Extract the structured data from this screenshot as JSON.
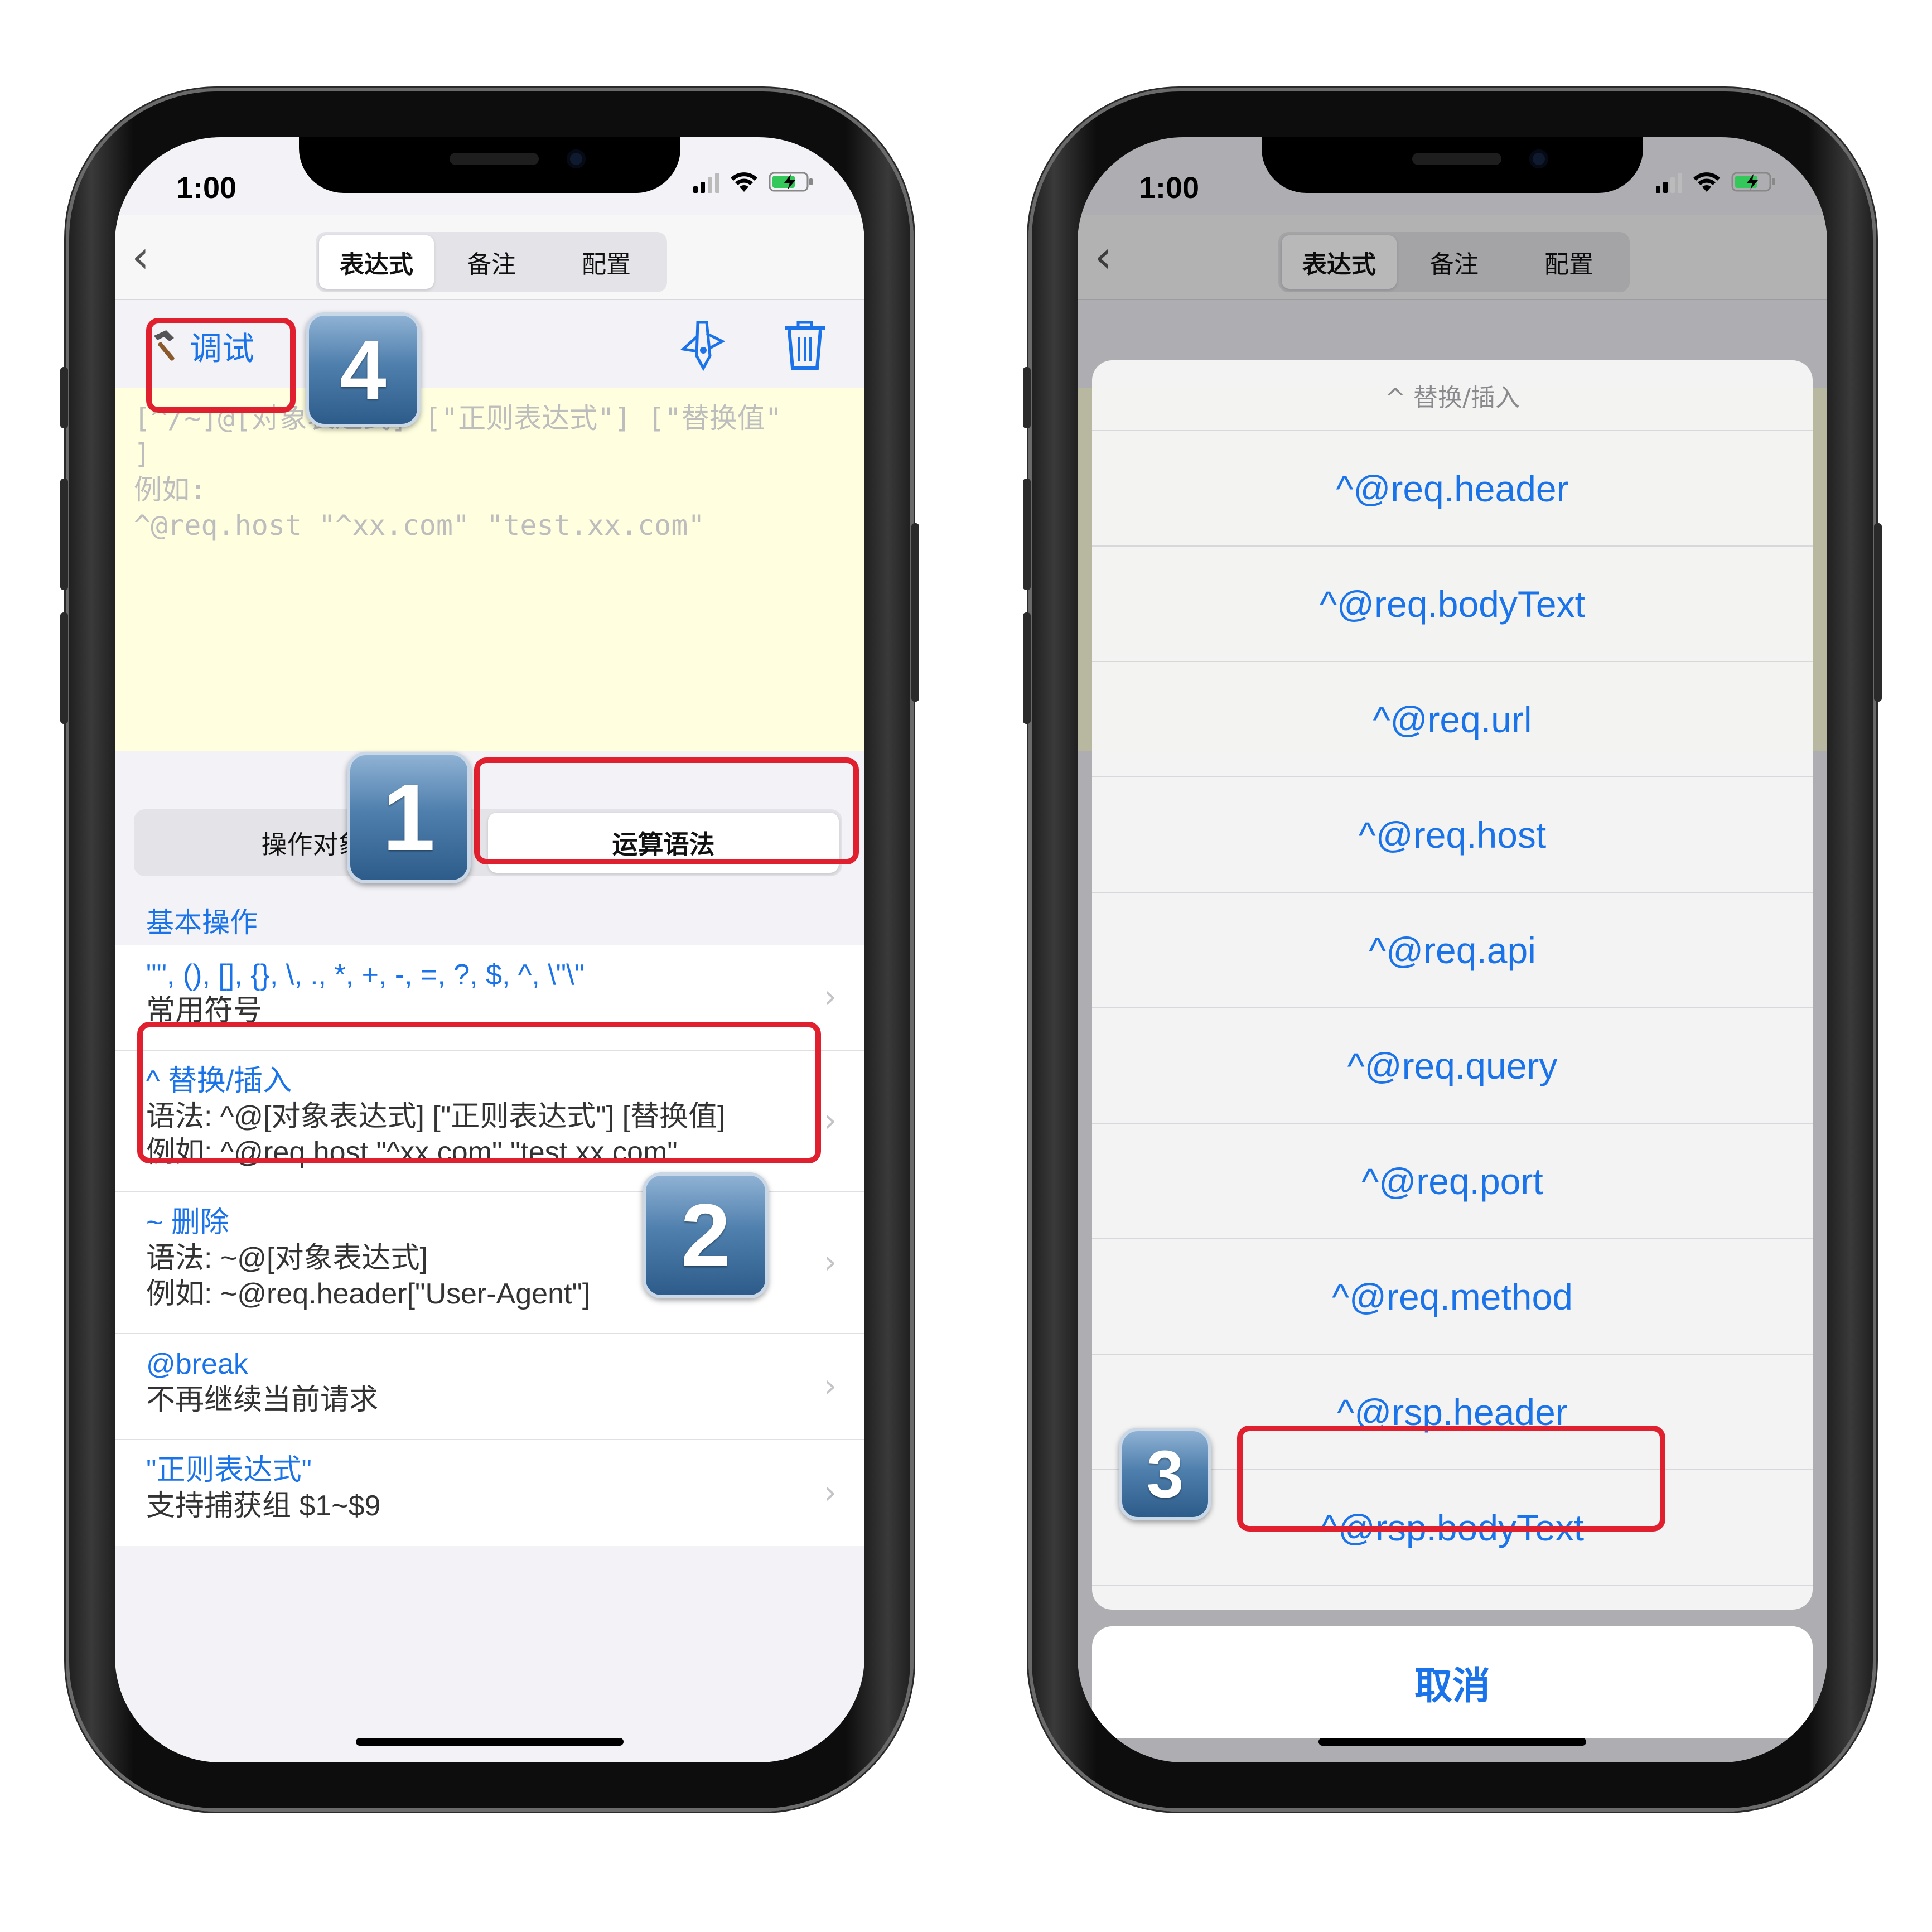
{
  "colors": {
    "accent": "#1a73e8",
    "highlight": "#e0202f",
    "editor_bg": "#ffffe0",
    "badge": "#4f7fad"
  },
  "left_phone": {
    "status": {
      "time": "1:00"
    },
    "nav": {
      "back_icon": "chevron-left-icon",
      "tabs": [
        "表达式",
        "备注",
        "配置"
      ],
      "active_tab": "表达式"
    },
    "toolbar": {
      "debug_label": "调试",
      "icons": [
        "hammer-icon",
        "swiss-knife-icon",
        "trash-icon"
      ]
    },
    "editor_placeholder": "[^/~]@[对象表达式] [\"正则表达式\"] [\"替换值\"\n]\n例如:\n^@req.host \"^xx.com\" \"test.xx.com\"",
    "subtabs": [
      "操作对象",
      "运算语法"
    ],
    "active_subtab": "运算语法",
    "section_header": "基本操作",
    "rows": [
      {
        "title": "\"\", (), [], {}, \\, ., *, +, -, =, ?, $, ^, \\\"\\\"",
        "lines": [
          "常用符号"
        ]
      },
      {
        "title": "^ 替换/插入",
        "lines": [
          "语法: ^@[对象表达式] [\"正则表达式\"] [替换值]",
          "例如: ^@req.host \"^xx.com\" \"test.xx.com\""
        ]
      },
      {
        "title": "~ 删除",
        "lines": [
          "语法: ~@[对象表达式]",
          "例如: ~@req.header[\"User-Agent\"]"
        ]
      },
      {
        "title": "@break",
        "lines": [
          "不再继续当前请求"
        ]
      },
      {
        "title": "\"正则表达式\"",
        "lines": [
          "支持捕获组 $1~$9"
        ]
      }
    ],
    "badges": [
      "4",
      "1",
      "2"
    ]
  },
  "right_phone": {
    "status": {
      "time": "1:00"
    },
    "nav": {
      "tabs": [
        "表达式",
        "备注",
        "配置"
      ]
    },
    "sheet": {
      "title": "^ 替换/插入",
      "options": [
        "^@req.header",
        "^@req.bodyText",
        "^@req.url",
        "^@req.host",
        "^@req.api",
        "^@req.query",
        "^@req.port",
        "^@req.method",
        "^@rsp.header",
        "^@rsp.bodyText"
      ],
      "cancel": "取消"
    },
    "badge": "3"
  }
}
